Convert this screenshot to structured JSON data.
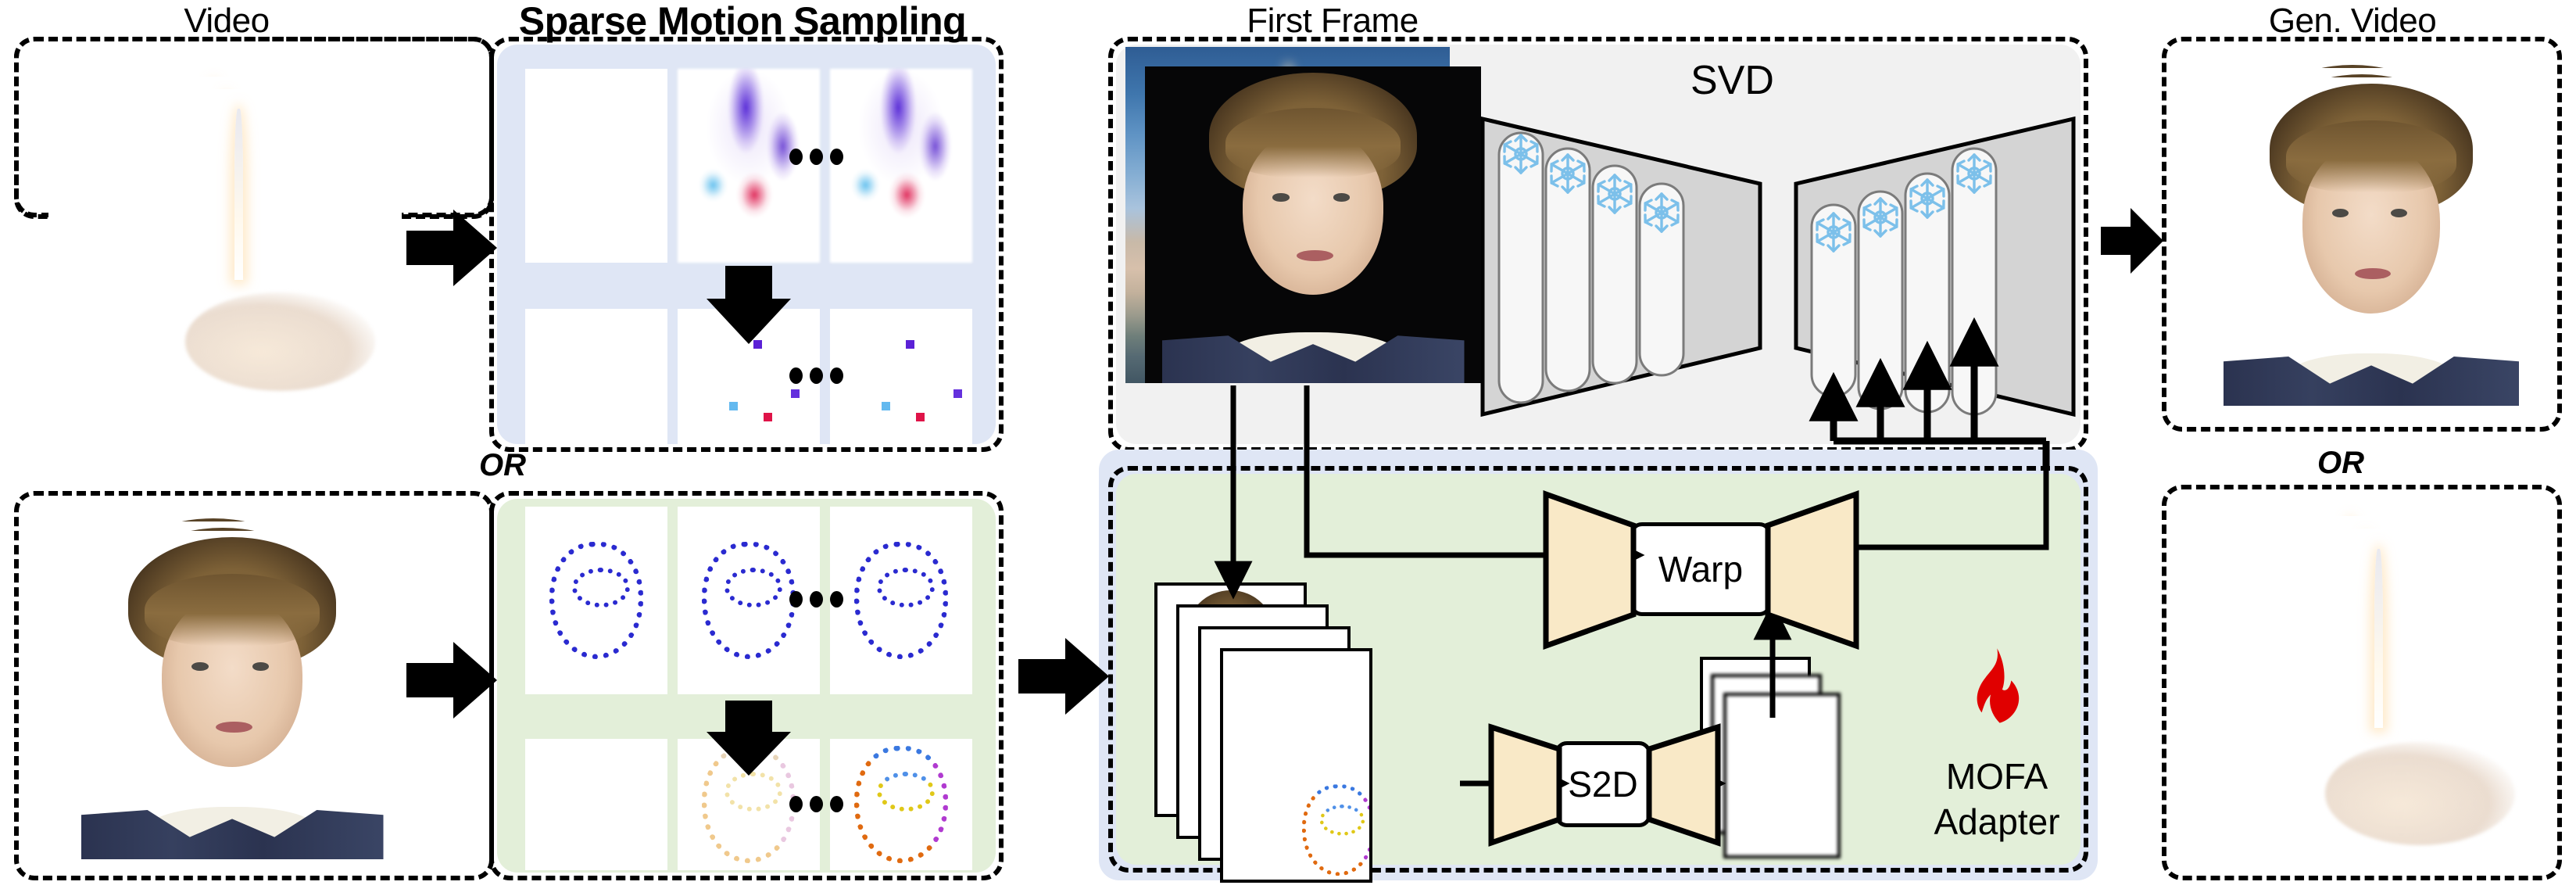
{
  "headers": {
    "video": "Video",
    "sparse_motion_sampling": "Sparse Motion Sampling",
    "first_frame": "First Frame",
    "gen_video": "Gen. Video"
  },
  "labels": {
    "or_left": "OR",
    "or_right": "OR",
    "svd": "SVD",
    "warp": "Warp",
    "s2d": "S2D",
    "mofa_line1": "MOFA",
    "mofa_line2": "Adapter"
  },
  "ellipsis": "...",
  "icons": {
    "snowflake": "snowflake-icon",
    "flame": "flame-icon",
    "arrow_right": "arrow-right-icon",
    "arrow_down": "arrow-down-icon",
    "arrow_up": "arrow-up-icon"
  },
  "colors": {
    "panel_blue": "#dfe6f5",
    "panel_green": "#e3efd9",
    "panel_gray": "#f1f1f1",
    "unet_gray": "#d4d4d4",
    "unet_tan": "#f9e9c7",
    "flame_red": "#e00000",
    "snowflake_blue": "#7cc0ea",
    "dashed_border": "#000000"
  },
  "panels": [
    {
      "name": "video-rocket-panel",
      "row": "top",
      "column": "video",
      "content": "rocket-launch-video-frames"
    },
    {
      "name": "sparse-motion-sampling-rocket-panel",
      "row": "top",
      "column": "sparse-motion-sampling",
      "content": "optical-flow-and-sparse-points"
    },
    {
      "name": "video-face-panel",
      "row": "bottom",
      "column": "video",
      "content": "face-video-frames"
    },
    {
      "name": "sparse-motion-sampling-face-panel",
      "row": "bottom",
      "column": "sparse-motion-sampling",
      "content": "facial-landmarks-and-colored-points"
    },
    {
      "name": "first-frame-svd-panel",
      "row": "top",
      "column": "first-frame",
      "content": "first-frame-and-svd-unet"
    },
    {
      "name": "mofa-adapter-panel",
      "row": "bottom",
      "column": "first-frame",
      "content": "mofa-adapter-pipeline"
    },
    {
      "name": "gen-video-face-panel",
      "row": "top",
      "column": "gen-video",
      "content": "generated-face-video-frames"
    },
    {
      "name": "gen-video-rocket-panel",
      "row": "bottom",
      "column": "gen-video",
      "content": "generated-rocket-video-frames"
    }
  ],
  "svd": {
    "encoder_blocks": 4,
    "decoder_blocks": 4,
    "frozen_blocks_total": 8,
    "injection_arrows": 4
  },
  "chart_data": {
    "type": "diagram",
    "title": "MOFA-Video pipeline overview",
    "stages": [
      "Video",
      "Sparse Motion Sampling",
      "First Frame",
      "Gen. Video"
    ],
    "branches": [
      "rocket / optical-flow branch",
      "face / landmark branch"
    ],
    "modules": [
      "SVD",
      "MOFA Adapter",
      "S2D",
      "Warp"
    ]
  }
}
